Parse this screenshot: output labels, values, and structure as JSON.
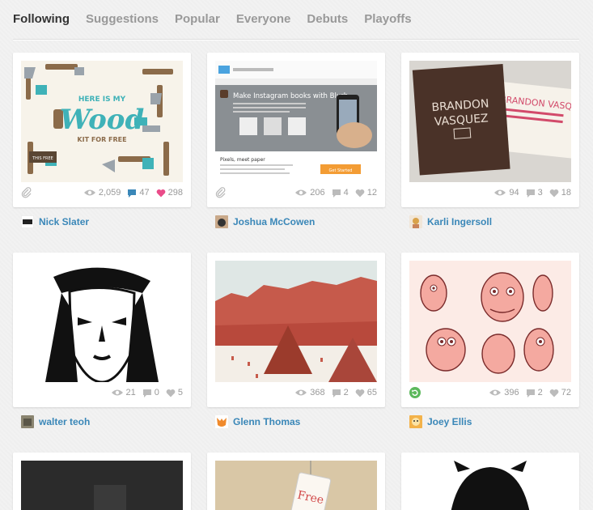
{
  "tabs": [
    {
      "label": "Following",
      "active": true
    },
    {
      "label": "Suggestions",
      "active": false
    },
    {
      "label": "Popular",
      "active": false
    },
    {
      "label": "Everyone",
      "active": false
    },
    {
      "label": "Debuts",
      "active": false
    },
    {
      "label": "Playoffs",
      "active": false
    }
  ],
  "shots": [
    {
      "views": "2,059",
      "comments": "47",
      "likes": "298",
      "player": "Nick Slater",
      "liked": true,
      "attachment": true,
      "art_text": {
        "top": "HERE IS MY",
        "main": "Wood",
        "bottom": "KIT FOR FREE",
        "badge": "THIS FREE"
      }
    },
    {
      "views": "206",
      "comments": "4",
      "likes": "12",
      "player": "Joshua McCowen",
      "attachment": true,
      "art_text": {
        "headline": "Make Instagram books with Blurb",
        "section": "Pixels, meet paper",
        "cta": "Get Started"
      }
    },
    {
      "views": "94",
      "comments": "3",
      "likes": "18",
      "player": "Karli Ingersoll",
      "art_text": {
        "name1": "BRANDON",
        "name2": "VASQUEZ",
        "card2": "BRANDON VASQUEZ"
      }
    },
    {
      "views": "21",
      "comments": "0",
      "likes": "5",
      "player": "walter teoh"
    },
    {
      "views": "368",
      "comments": "2",
      "likes": "65",
      "player": "Glenn Thomas"
    },
    {
      "views": "396",
      "comments": "2",
      "likes": "72",
      "player": "Joey Ellis",
      "rebound": true
    }
  ],
  "partial_shots": [
    {
      "art_text": "Free"
    }
  ],
  "colors": {
    "accent_link": "#3a87b8",
    "active_tab": "#333333",
    "inactive_tab": "#999999",
    "liked_heart": "#ea4c89",
    "rebound_green": "#5cb85c"
  }
}
